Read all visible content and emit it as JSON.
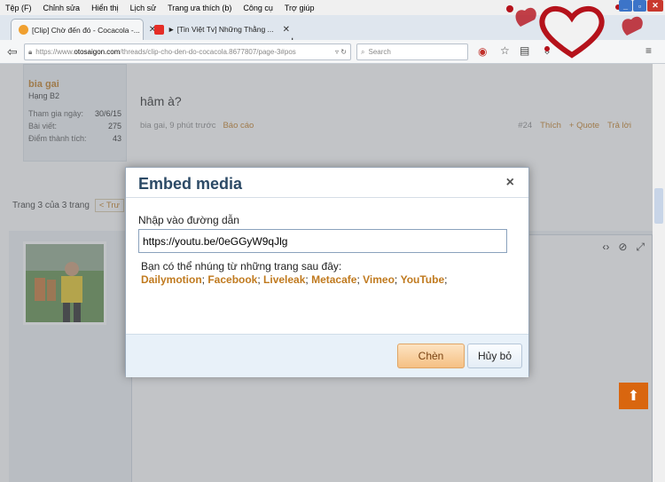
{
  "browser": {
    "menu": [
      "Tệp (F)",
      "Chỉnh sửa",
      "Hiển thị",
      "Lịch sử",
      "Trang ưa thích (b)",
      "Công cụ",
      "Trợ giúp"
    ],
    "tabs": [
      {
        "label": "[Clip] Chờ đến đó - Cocacola -...",
        "active": true
      },
      {
        "label": "► [Tin Việt Tv] Những Thằng ...",
        "active": false
      }
    ],
    "url_prefix": "https://www.",
    "url_host": "otosaigon.com",
    "url_path": "/threads/clip-cho-den-do-cocacola.8677807/page-3#pos",
    "search_placeholder": "Search"
  },
  "sidebar_user": {
    "name": "bia gai",
    "rank": "Hạng B2",
    "stats": [
      {
        "label": "Tham gia ngày:",
        "value": "30/6/15"
      },
      {
        "label": "Bài viết:",
        "value": "275"
      },
      {
        "label": "Điểm thành tích:",
        "value": "43"
      }
    ]
  },
  "post": {
    "message": "hâm à?",
    "author_time": "bia gai, 9 phút trước",
    "report": "Báo cáo",
    "number": "#24",
    "like": "Thích",
    "quote": "+ Quote",
    "reply": "Trả lời"
  },
  "pager": {
    "text": "Trang 3 của 3 trang",
    "prev": "< Trư"
  },
  "modal": {
    "title": "Embed media",
    "close": "×",
    "url_label": "Nhập vào đường dẫn",
    "url_value": "https://youtu.be/0eGGyW9qJlg",
    "embed_note": "Bạn có thể nhúng từ những trang sau đây:",
    "providers": [
      "Dailymotion",
      "Facebook",
      "Liveleak",
      "Metacafe",
      "Vimeo",
      "YouTube"
    ],
    "insert": "Chèn",
    "cancel": "Hủy bỏ"
  },
  "colors": {
    "accent": "#c07a1f",
    "title": "#2c4a66",
    "scroll_top": "#d9660f"
  }
}
